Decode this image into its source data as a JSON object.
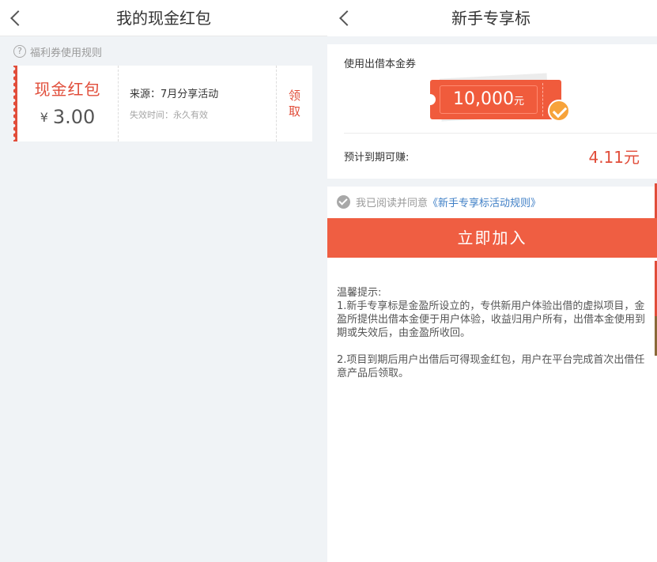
{
  "left_screen": {
    "nav_title": "我的现金红包",
    "rules_label": "福利券使用规则",
    "coupon": {
      "title": "现金红包",
      "currency": "¥",
      "amount": "3.00",
      "source": "来源：7月分享活动",
      "expire": "失效时间：永久有效",
      "claim_line1": "领",
      "claim_line2": "取"
    }
  },
  "right_screen": {
    "nav_title": "新手专享标",
    "voucher_label": "使用出借本金券",
    "voucher_amount": "10,000",
    "voucher_unit": "元",
    "earn_label": "预计到期可赚:",
    "earn_value": "4.11元",
    "agree_text": "我已阅读并同意",
    "agree_link": "《新手专享标活动规则》",
    "join_button": "立即加入",
    "tips": {
      "title": "温馨提示:",
      "item1": "1.新手专享标是金盈所设立的，专供新用户体验出借的虚拟项目，金盈所提供出借本金便于用户体验，收益归用户所有，出借本金使用到期或失效后，由金盈所收回。",
      "item2": "2.项目到期后用户出借后可得现金红包，用户在平台完成首次出借任意产品后领取。"
    }
  },
  "colors": {
    "accent": "#e14d3a",
    "button": "#ef5e42",
    "badge": "#f7a33a",
    "link": "#3f7fc6"
  },
  "icons": [
    "back-arrow-icon",
    "question-circle-icon",
    "check-badge-icon",
    "check-circle-icon"
  ]
}
